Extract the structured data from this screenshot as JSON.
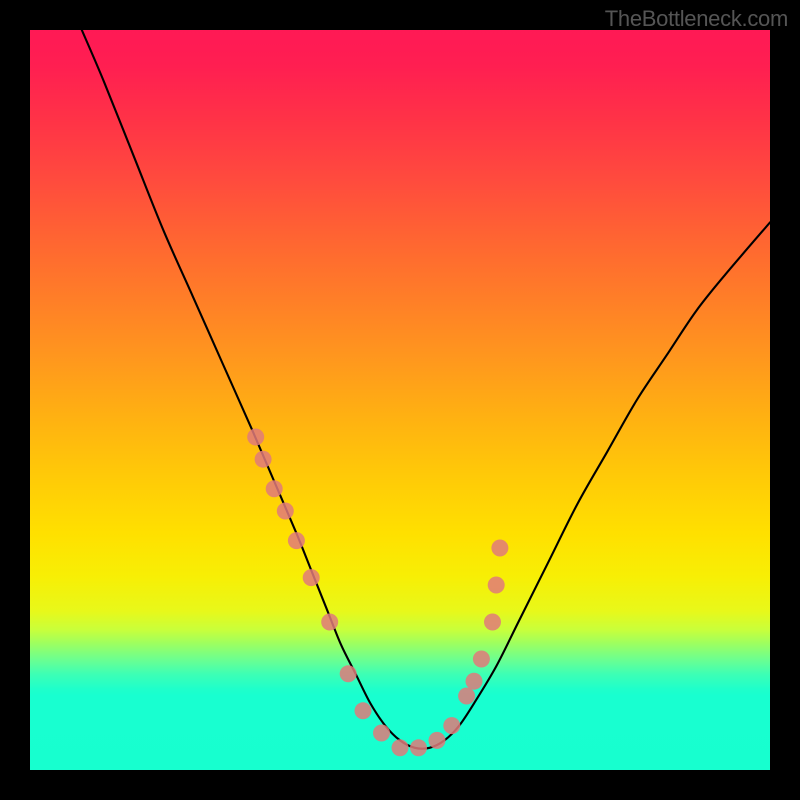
{
  "watermark": "TheBottleneck.com",
  "chart_data": {
    "type": "line",
    "title": "",
    "xlabel": "",
    "ylabel": "",
    "xlim": [
      0,
      100
    ],
    "ylim": [
      0,
      100
    ],
    "grid": false,
    "series": [
      {
        "name": "curve",
        "color": "#000000",
        "x": [
          7,
          10,
          14,
          18,
          22,
          26,
          30,
          33,
          36,
          38,
          40,
          42,
          44,
          46,
          48,
          50,
          52,
          54,
          56,
          58,
          60,
          63,
          66,
          70,
          74,
          78,
          82,
          86,
          90,
          94,
          100
        ],
        "values": [
          100,
          93,
          83,
          73,
          64,
          55,
          46,
          39,
          32,
          27,
          22,
          17,
          13,
          9,
          6,
          4,
          3,
          3,
          4,
          6,
          9,
          14,
          20,
          28,
          36,
          43,
          50,
          56,
          62,
          67,
          74
        ]
      },
      {
        "name": "dots-cluster",
        "color": "#e07a7a",
        "type": "scatter",
        "x": [
          30.5,
          31.5,
          33.0,
          34.5,
          36.0,
          38.0,
          40.5,
          43.0,
          45.0,
          47.5,
          50.0,
          52.5,
          55.0,
          57.0,
          59.0,
          60.0,
          61.0,
          62.5,
          63.0,
          63.5
        ],
        "values": [
          45,
          42,
          38,
          35,
          31,
          26,
          20,
          13,
          8,
          5,
          3,
          3,
          4,
          6,
          10,
          12,
          15,
          20,
          25,
          30
        ]
      }
    ],
    "gradient_stops": [
      {
        "pos": 0.0,
        "color": "#ff1955"
      },
      {
        "pos": 0.2,
        "color": "#ff4a3e"
      },
      {
        "pos": 0.44,
        "color": "#ff961e"
      },
      {
        "pos": 0.68,
        "color": "#ffe000"
      },
      {
        "pos": 0.83,
        "color": "#9bff62"
      },
      {
        "pos": 0.9,
        "color": "#18ffd0"
      },
      {
        "pos": 1.0,
        "color": "#17ffcf"
      }
    ]
  }
}
